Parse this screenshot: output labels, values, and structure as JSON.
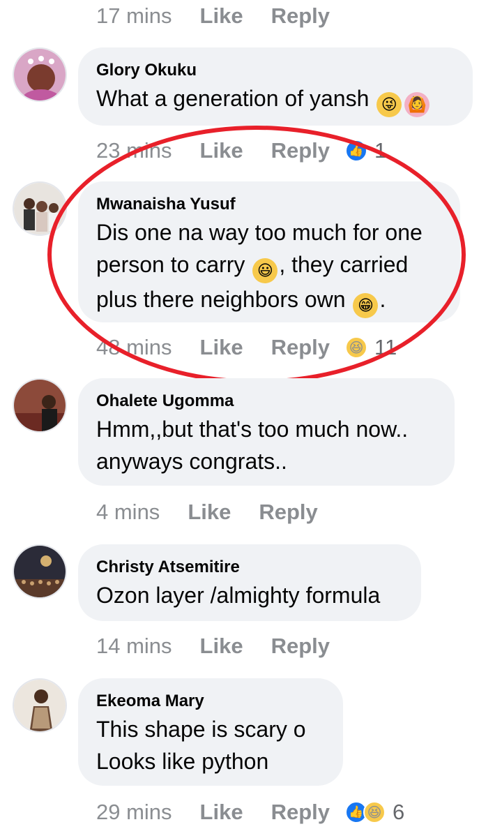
{
  "top_meta": {
    "time": "17 mins",
    "like": "Like",
    "reply": "Reply"
  },
  "comments": [
    {
      "name": "Glory Okuku",
      "text": "What a generation of yansh",
      "emojis": [
        "😜",
        "🙆"
      ],
      "time": "23 mins",
      "like": "Like",
      "reply": "Reply",
      "reaction_count": "1",
      "reaction_icons": [
        "like-icon"
      ]
    },
    {
      "name": "Mwanaisha Yusuf",
      "text_part1": "Dis one na way too much for one person to carry",
      "text_part2": ", they carried plus there neighbors own",
      "text_part3": ".",
      "emojis": [
        "😃",
        "😁"
      ],
      "time": "48 mins",
      "like": "Like",
      "reply": "Reply",
      "reaction_count": "11",
      "reaction_icons": [
        "haha-icon"
      ]
    },
    {
      "name": "Ohalete Ugomma",
      "line1": "Hmm,,but that's too much now..",
      "line2": "anyways congrats..",
      "time": "4 mins",
      "like": "Like",
      "reply": "Reply"
    },
    {
      "name": "Christy Atsemitire",
      "text": "Ozon layer /almighty formula",
      "time": "14 mins",
      "like": "Like",
      "reply": "Reply"
    },
    {
      "name": "Ekeoma Mary",
      "line1": "This shape is scary o",
      "line2": "Looks like python",
      "time": "29 mins",
      "like": "Like",
      "reply": "Reply",
      "reaction_count": "6",
      "reaction_icons": [
        "like-icon",
        "haha-icon"
      ]
    }
  ],
  "colors": {
    "bubble": "#f0f2f5",
    "meta_text": "#8a8d91",
    "like_blue": "#1877f2",
    "haha_yellow": "#f7c94b",
    "annotation_red": "#e8202a"
  }
}
